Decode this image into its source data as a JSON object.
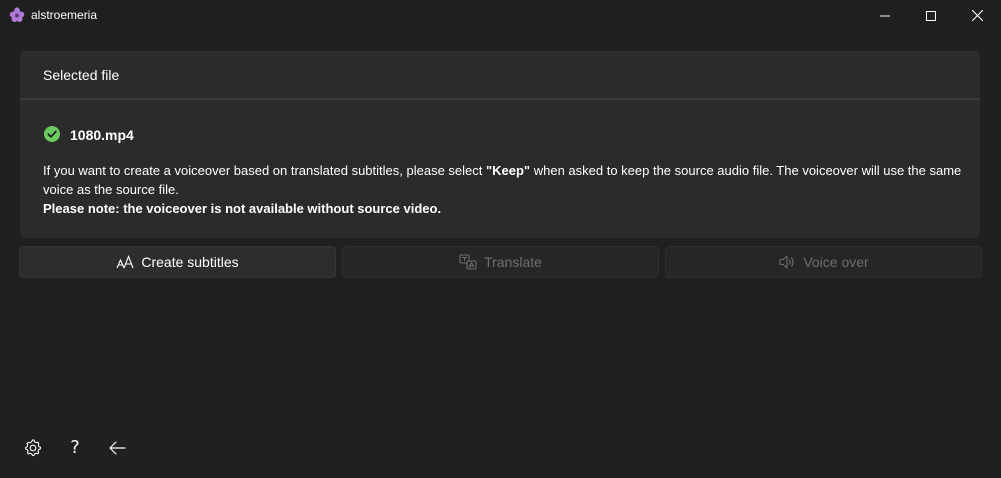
{
  "window": {
    "title": "alstroemeria",
    "controls": [
      "minimize-icon",
      "maximize-icon",
      "close-icon"
    ]
  },
  "card": {
    "title": "Selected file",
    "file_name": "1080.mp4",
    "status_icon": "check-circle-icon",
    "status_color": "#6ccb5f",
    "info_before": "If you want to create a voiceover based on translated subtitles, please select ",
    "info_keyword": "\"Keep\"",
    "info_after": " when asked to keep the source audio file. The voiceover will use the same voice as the source file.",
    "note": "Please note: the voiceover is not available without source video."
  },
  "actions": [
    {
      "label": "Create subtitles",
      "icon": "font-size-icon",
      "enabled": true
    },
    {
      "label": "Translate",
      "icon": "translate-icon",
      "enabled": false
    },
    {
      "label": "Voice over",
      "icon": "speaker-icon",
      "enabled": false
    }
  ],
  "footer": {
    "icons": [
      "settings-icon",
      "help-icon",
      "back-arrow-icon"
    ],
    "help_glyph": "?"
  },
  "colors": {
    "background": "#202020",
    "card": "#2b2b2b",
    "app_icon": "#b07bd8"
  }
}
